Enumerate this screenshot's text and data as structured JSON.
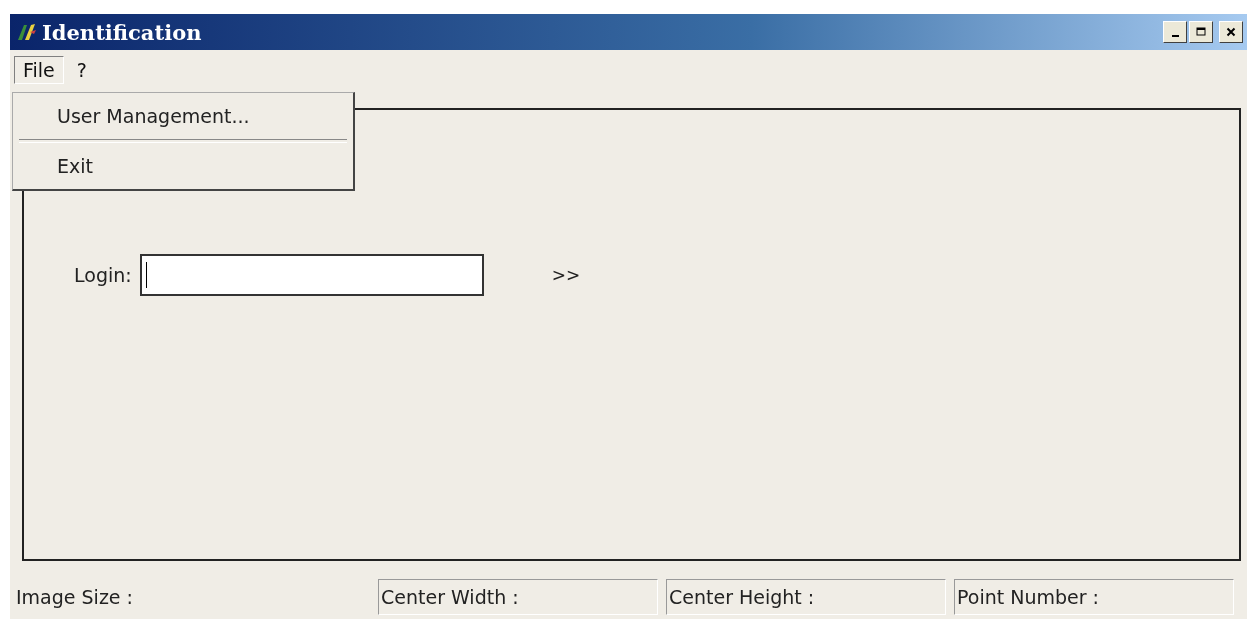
{
  "window": {
    "title": "Identification"
  },
  "menu_bar": [
    {
      "label": "File",
      "selected": true
    },
    {
      "label": "?",
      "selected": false
    }
  ],
  "file_menu": {
    "items": [
      {
        "kind": "item",
        "label": "User Management..."
      },
      {
        "kind": "separator"
      },
      {
        "kind": "item",
        "label": "Exit"
      }
    ]
  },
  "login": {
    "label": "Login:"
  },
  "next_button": ">>",
  "status_bar": [
    {
      "label": "Image Size :",
      "sunken": false
    },
    {
      "label": "Center Width :",
      "sunken": true
    },
    {
      "label": "Center Height :",
      "sunken": true
    },
    {
      "label": "Point Number :",
      "sunken": true
    }
  ]
}
